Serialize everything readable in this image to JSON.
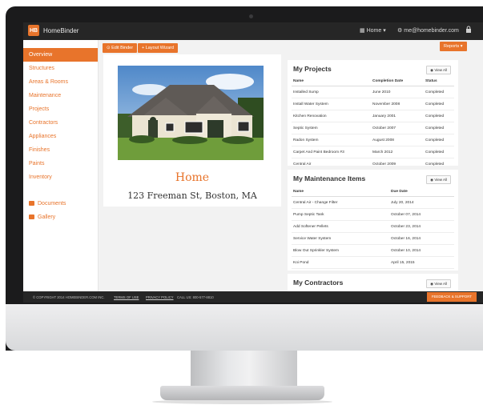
{
  "app": {
    "brand": "HomeBinder",
    "logo_text": "HB",
    "nav_home": "Home",
    "nav_user": "me@homebinder.com",
    "accent_color": "#e8742b"
  },
  "sidebar": {
    "items": [
      {
        "label": "Overview"
      },
      {
        "label": "Structures"
      },
      {
        "label": "Areas & Rooms"
      },
      {
        "label": "Maintenance"
      },
      {
        "label": "Projects"
      },
      {
        "label": "Contractors"
      },
      {
        "label": "Appliances"
      },
      {
        "label": "Finishes"
      },
      {
        "label": "Paints"
      },
      {
        "label": "Inventory"
      }
    ],
    "extra": [
      {
        "label": "Documents"
      },
      {
        "label": "Gallery"
      }
    ]
  },
  "toolbar": {
    "edit_binder": "Edit Binder",
    "layout_wizard": "Layout Wizard",
    "reports": "Reports"
  },
  "home": {
    "title": "Home",
    "address": "123 Freeman St, Boston, MA"
  },
  "projects": {
    "title": "My Projects",
    "view_all": "View All",
    "columns": [
      "Name",
      "Completion Date",
      "Status"
    ],
    "rows": [
      [
        "Installed Sump",
        "June 2010",
        "Completed"
      ],
      [
        "Install Water System",
        "November 2008",
        "Completed"
      ],
      [
        "Kitchen Renovation",
        "January 2001",
        "Completed"
      ],
      [
        "Septic System",
        "October 2007",
        "Completed"
      ],
      [
        "Radon System",
        "August 2008",
        "Completed"
      ],
      [
        "Carpet And Paint Bedroom #3",
        "March 2012",
        "Completed"
      ],
      [
        "Central Air",
        "October 2009",
        "Completed"
      ]
    ]
  },
  "maintenance": {
    "title": "My Maintenance Items",
    "view_all": "View All",
    "columns": [
      "Name",
      "Due Date"
    ],
    "rows": [
      [
        "Central Air - Change Filter",
        "July 20, 2014"
      ],
      [
        "Pump Septic Tank",
        "October 07, 2014"
      ],
      [
        "Add Softener Pellets",
        "October 23, 2014"
      ],
      [
        "Service Water System",
        "October 16, 2014"
      ],
      [
        "Blow Out Sprinkler System",
        "October 10, 2014"
      ],
      [
        "Koi Pond",
        "April 15, 2015"
      ]
    ]
  },
  "contractors": {
    "title": "My Contractors",
    "view_all": "View All"
  },
  "footer": {
    "copyright": "© COPYRIGHT 2014 HOMEBINDER.COM INC.",
    "terms": "TERMS OF USE",
    "privacy": "PRIVACY POLICY",
    "call": "CALL US: 800-577-8810",
    "feedback": "FEEDBACK & SUPPORT"
  }
}
